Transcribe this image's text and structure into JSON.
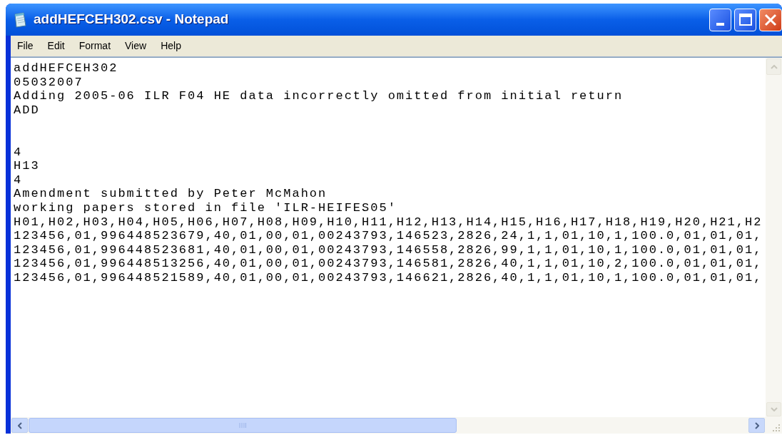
{
  "window": {
    "title": "addHEFCEH302.csv - Notepad"
  },
  "menu": [
    {
      "label": "File"
    },
    {
      "label": "Edit"
    },
    {
      "label": "Format"
    },
    {
      "label": "View"
    },
    {
      "label": "Help"
    }
  ],
  "lines": [
    {
      "kind": "text",
      "text": "addHEFCEH302"
    },
    {
      "kind": "text",
      "text": "05032007"
    },
    {
      "kind": "text",
      "text": "Adding 2005-06 ILR F04 HE data incorrectly omitted from initial return"
    },
    {
      "kind": "text",
      "text": "ADD"
    },
    {
      "kind": "blank"
    },
    {
      "kind": "blank"
    },
    {
      "kind": "text",
      "text": "4"
    },
    {
      "kind": "text",
      "text": "H13"
    },
    {
      "kind": "text",
      "text": "4"
    },
    {
      "kind": "text",
      "text": "Amendment submitted by Peter McMahon"
    },
    {
      "kind": "text",
      "text": "working papers stored in file 'ILR-HEIFES05'"
    },
    {
      "kind": "text",
      "text": "H01,H02,H03,H04,H05,H06,H07,H08,H09,H10,H11,H12,H13,H14,H15,H16,H17,H18,H19,H20,H21,H2"
    },
    {
      "kind": "text",
      "text": "123456,01,996448523679,40,01,00,01,00243793,146523,2826,24,1,1,01,10,1,100.0,01,01,01,"
    },
    {
      "kind": "text",
      "text": "123456,01,996448523681,40,01,00,01,00243793,146558,2826,99,1,1,01,10,1,100.0,01,01,01,"
    },
    {
      "kind": "text",
      "text": "123456,01,996448513256,40,01,00,01,00243793,146581,2826,40,1,1,01,10,2,100.0,01,01,01,"
    },
    {
      "kind": "text",
      "text": "123456,01,996448521589,40,01,00,01,00243793,146621,2826,40,1,1,01,10,1,100.0,01,01,01,"
    }
  ]
}
